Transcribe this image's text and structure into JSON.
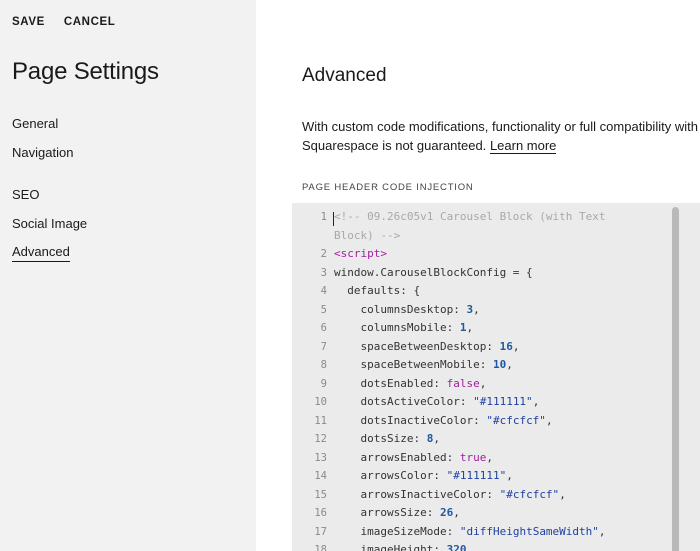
{
  "sidebar": {
    "save_label": "SAVE",
    "cancel_label": "CANCEL",
    "title": "Page Settings",
    "items": [
      {
        "label": "General"
      },
      {
        "label": "Navigation"
      },
      {
        "label": "SEO"
      },
      {
        "label": "Social Image"
      },
      {
        "label": "Advanced"
      }
    ],
    "active_item": "Advanced"
  },
  "main": {
    "title": "Advanced",
    "description": "With custom code modifications, functionality or full compatibility with Squarespace is not guaranteed.",
    "learn_more": "Learn more",
    "code_label": "PAGE HEADER CODE INJECTION"
  },
  "code": {
    "lines": [
      {
        "n": "1",
        "parts": [
          {
            "t": "<!-- 09.26c05v1 Carousel Block (with Text",
            "c": "comment"
          }
        ]
      },
      {
        "n": "",
        "parts": [
          {
            "t": "Block) -->",
            "c": "comment"
          }
        ]
      },
      {
        "n": "2",
        "parts": [
          {
            "t": "<script>",
            "c": "tag"
          }
        ]
      },
      {
        "n": "3",
        "parts": [
          {
            "t": "window.CarouselBlockConfig = {",
            "c": "plain"
          }
        ]
      },
      {
        "n": "4",
        "parts": [
          {
            "t": "  defaults: {",
            "c": "plain"
          }
        ]
      },
      {
        "n": "5",
        "parts": [
          {
            "t": "    columnsDesktop: ",
            "c": "plain"
          },
          {
            "t": "3",
            "c": "num"
          },
          {
            "t": ",",
            "c": "plain"
          }
        ]
      },
      {
        "n": "6",
        "parts": [
          {
            "t": "    columnsMobile: ",
            "c": "plain"
          },
          {
            "t": "1",
            "c": "num"
          },
          {
            "t": ",",
            "c": "plain"
          }
        ]
      },
      {
        "n": "7",
        "parts": [
          {
            "t": "    spaceBetweenDesktop: ",
            "c": "plain"
          },
          {
            "t": "16",
            "c": "num"
          },
          {
            "t": ",",
            "c": "plain"
          }
        ]
      },
      {
        "n": "8",
        "parts": [
          {
            "t": "    spaceBetweenMobile: ",
            "c": "plain"
          },
          {
            "t": "10",
            "c": "num"
          },
          {
            "t": ",",
            "c": "plain"
          }
        ]
      },
      {
        "n": "9",
        "parts": [
          {
            "t": "    dotsEnabled: ",
            "c": "plain"
          },
          {
            "t": "false",
            "c": "kw"
          },
          {
            "t": ",",
            "c": "plain"
          }
        ]
      },
      {
        "n": "10",
        "parts": [
          {
            "t": "    dotsActiveColor: ",
            "c": "plain"
          },
          {
            "t": "\"#111111\"",
            "c": "str"
          },
          {
            "t": ",",
            "c": "plain"
          }
        ]
      },
      {
        "n": "11",
        "parts": [
          {
            "t": "    dotsInactiveColor: ",
            "c": "plain"
          },
          {
            "t": "\"#cfcfcf\"",
            "c": "str"
          },
          {
            "t": ",",
            "c": "plain"
          }
        ]
      },
      {
        "n": "12",
        "parts": [
          {
            "t": "    dotsSize: ",
            "c": "plain"
          },
          {
            "t": "8",
            "c": "num"
          },
          {
            "t": ",",
            "c": "plain"
          }
        ]
      },
      {
        "n": "13",
        "parts": [
          {
            "t": "    arrowsEnabled: ",
            "c": "plain"
          },
          {
            "t": "true",
            "c": "kw"
          },
          {
            "t": ",",
            "c": "plain"
          }
        ]
      },
      {
        "n": "14",
        "parts": [
          {
            "t": "    arrowsColor: ",
            "c": "plain"
          },
          {
            "t": "\"#111111\"",
            "c": "str"
          },
          {
            "t": ",",
            "c": "plain"
          }
        ]
      },
      {
        "n": "15",
        "parts": [
          {
            "t": "    arrowsInactiveColor: ",
            "c": "plain"
          },
          {
            "t": "\"#cfcfcf\"",
            "c": "str"
          },
          {
            "t": ",",
            "c": "plain"
          }
        ]
      },
      {
        "n": "16",
        "parts": [
          {
            "t": "    arrowsSize: ",
            "c": "plain"
          },
          {
            "t": "26",
            "c": "num"
          },
          {
            "t": ",",
            "c": "plain"
          }
        ]
      },
      {
        "n": "17",
        "parts": [
          {
            "t": "    imageSizeMode: ",
            "c": "plain"
          },
          {
            "t": "\"diffHeightSameWidth\"",
            "c": "str"
          },
          {
            "t": ",",
            "c": "plain"
          }
        ]
      },
      {
        "n": "18",
        "parts": [
          {
            "t": "    imageHeight: ",
            "c": "plain"
          },
          {
            "t": "320",
            "c": "num"
          },
          {
            "t": ",",
            "c": "plain"
          }
        ]
      }
    ]
  }
}
